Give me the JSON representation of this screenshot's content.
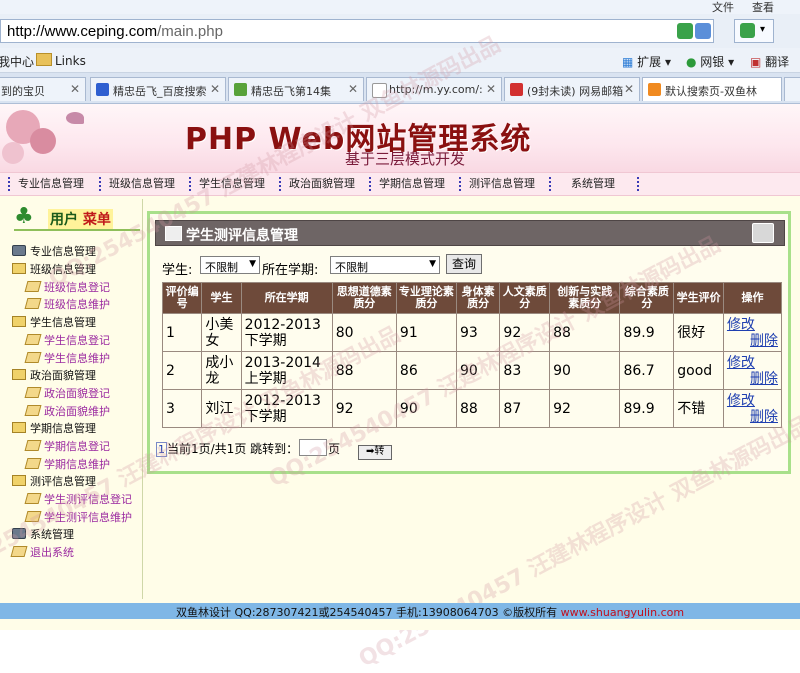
{
  "browser": {
    "menu": [
      "文件",
      "查看"
    ],
    "address": {
      "domain": "http://www.ceping.com",
      "path": "/main.php"
    },
    "favorites": {
      "left_cut": "我中心",
      "links": "Links",
      "extend": "扩展",
      "bank": "网银",
      "translate": "翻译"
    },
    "tabs": [
      {
        "label": "到的宝贝"
      },
      {
        "label": "精忠岳飞_百度搜索"
      },
      {
        "label": "精忠岳飞第14集"
      },
      {
        "label": "http://m.yy.com/:"
      },
      {
        "label": "(9封未读) 网易邮箱"
      },
      {
        "label": "默认搜索页-双鱼林"
      }
    ]
  },
  "site": {
    "title": "PHP Web网站管理系统",
    "subtitle": "基于三层模式开发"
  },
  "nav": [
    "专业信息管理",
    "班级信息管理",
    "学生信息管理",
    "政治面貌管理",
    "学期信息管理",
    "测评信息管理",
    "系统管理"
  ],
  "sidebar": {
    "title_a": "用户",
    "title_b": "菜单",
    "groups": [
      {
        "label": "专业信息管理",
        "icon": "system",
        "items": []
      },
      {
        "label": "班级信息管理",
        "icon": "folder",
        "items": [
          "班级信息登记",
          "班级信息维护"
        ]
      },
      {
        "label": "学生信息管理",
        "icon": "folder",
        "items": [
          "学生信息登记",
          "学生信息维护"
        ]
      },
      {
        "label": "政治面貌管理",
        "icon": "folder",
        "items": [
          "政治面貌登记",
          "政治面貌维护"
        ]
      },
      {
        "label": "学期信息管理",
        "icon": "folder",
        "items": [
          "学期信息登记",
          "学期信息维护"
        ]
      },
      {
        "label": "测评信息管理",
        "icon": "folder",
        "items": [
          "学生测评信息登记",
          "学生测评信息维护"
        ]
      },
      {
        "label": "系统管理",
        "icon": "system",
        "items": []
      },
      {
        "label": "退出系统",
        "icon": "page",
        "items": []
      }
    ]
  },
  "panel": {
    "title": "学生测评信息管理",
    "filter": {
      "student_label": "学生:",
      "student_value": "不限制",
      "term_label": "所在学期:",
      "term_value": "不限制",
      "query_button": "查询"
    },
    "table": {
      "headers": [
        "评价编号",
        "学生",
        "所在学期",
        "思想道德素质分",
        "专业理论素质分",
        "身体素质分",
        "人文素质分",
        "创新与实践素质分",
        "综合素质分",
        "学生评价",
        "操作"
      ],
      "rows": [
        [
          "1",
          "小美女",
          "2012-2013下学期",
          "80",
          "91",
          "93",
          "92",
          "88",
          "89.9",
          "很好"
        ],
        [
          "2",
          "成小龙",
          "2013-2014上学期",
          "88",
          "86",
          "90",
          "83",
          "90",
          "86.7",
          "good"
        ],
        [
          "3",
          "刘江",
          "2012-2013下学期",
          "92",
          "90",
          "88",
          "87",
          "92",
          "89.9",
          "不错"
        ]
      ],
      "op_edit": "修改",
      "op_delete": "删除"
    },
    "pager": {
      "page_link": "1",
      "text": "当前1页/共1页 跳转到：",
      "unit": "页",
      "go": "➡转"
    }
  },
  "footer": {
    "text": "双鱼林设计 QQ:287307421或254540457 手机:13908064703 ©版权所有 ",
    "link": "www.shuangyulin.com"
  },
  "watermark": "QQ:254540457 汪建林程序设计 双鱼林源码出品"
}
